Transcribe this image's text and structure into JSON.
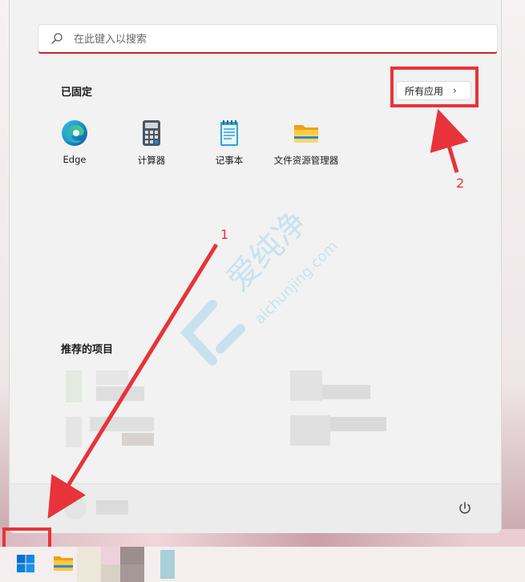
{
  "search": {
    "placeholder": "在此键入以搜索"
  },
  "pinned": {
    "title": "已固定",
    "all_apps_label": "所有应用",
    "apps": [
      {
        "label": "Edge",
        "icon": "edge-icon"
      },
      {
        "label": "计算器",
        "icon": "calculator-icon"
      },
      {
        "label": "记事本",
        "icon": "notepad-icon"
      },
      {
        "label": "文件资源管理器",
        "icon": "folder-icon"
      }
    ]
  },
  "recommended": {
    "title": "推荐的项目"
  },
  "annotations": {
    "one": "1",
    "two": "2"
  },
  "watermark": {
    "text": "爱纯净",
    "url": "aichunjing.com"
  },
  "colors": {
    "annotation": "#e8333a",
    "accent": "#0a6ed1",
    "search_underline": "#c4262b"
  }
}
